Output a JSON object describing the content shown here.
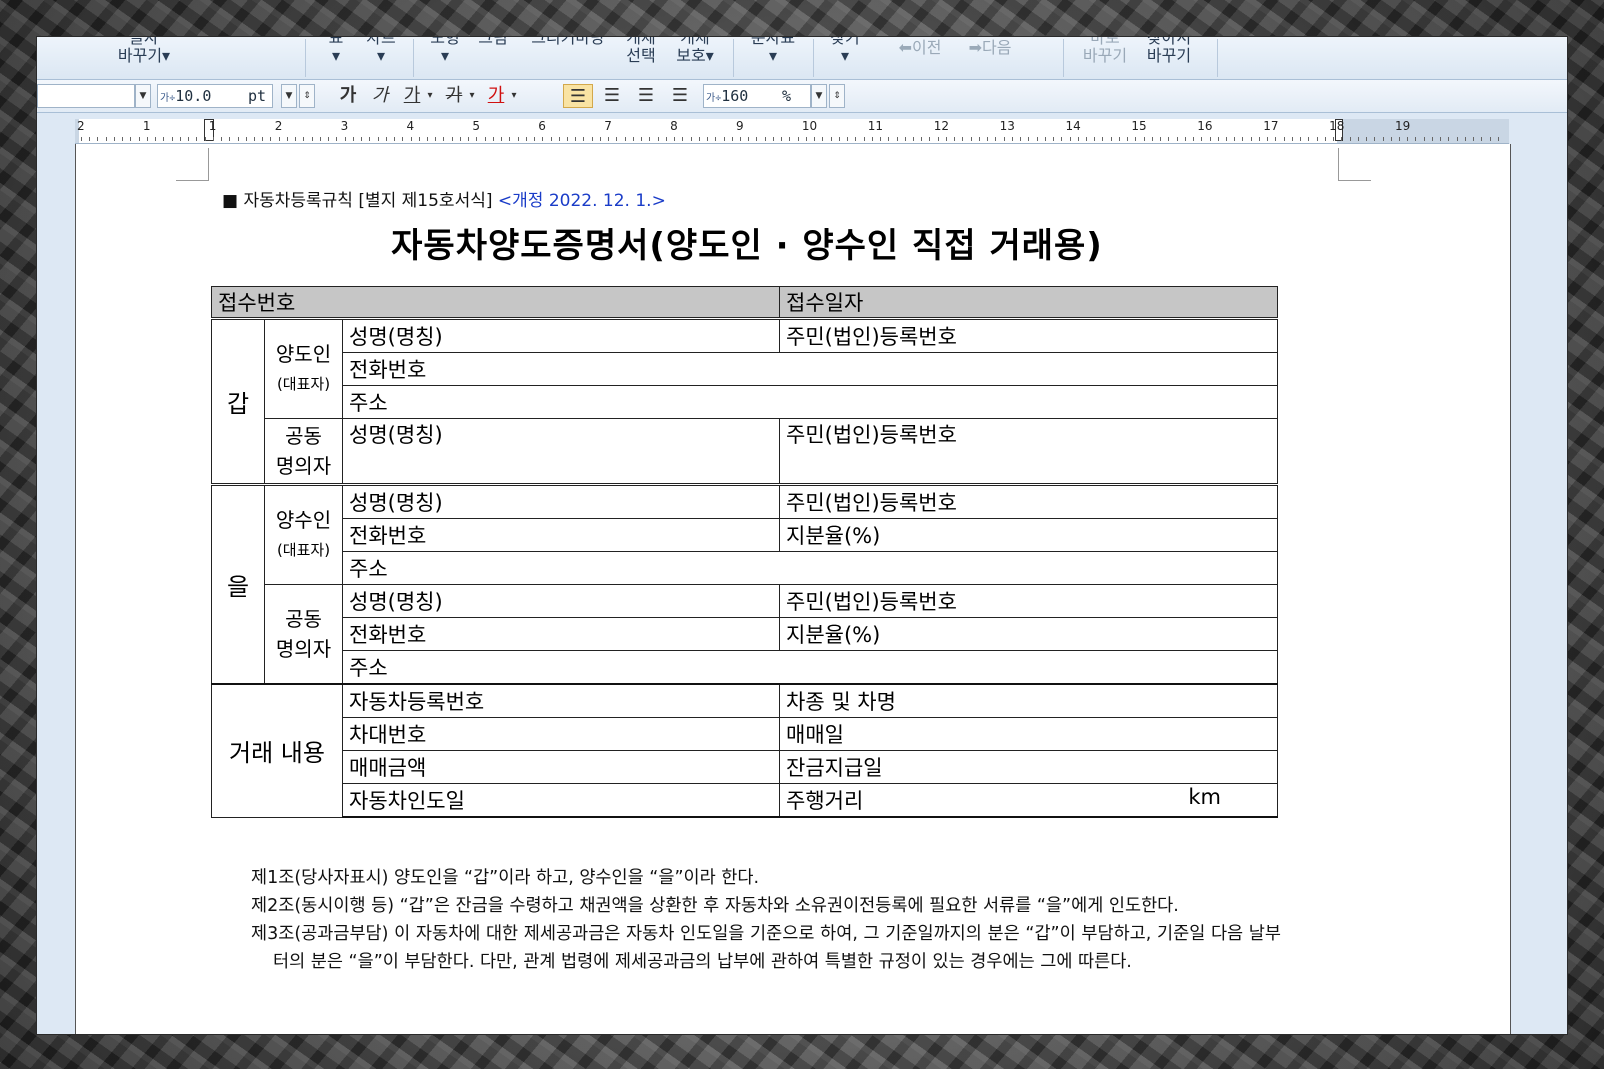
{
  "ribbon": {
    "groups": [
      {
        "top": "글자",
        "bottom": "바꾸기▾"
      },
      {
        "top": "표",
        "bottom": "▾"
      },
      {
        "top": "차트",
        "bottom": "▾"
      },
      {
        "top": "도형",
        "bottom": "▾"
      },
      {
        "top": "그림",
        "bottom": ""
      },
      {
        "top": "그리기마당",
        "bottom": ""
      },
      {
        "top": "개체",
        "bottom": "선택"
      },
      {
        "top": "개체",
        "bottom": "보호▾"
      },
      {
        "top": "문자표",
        "bottom": "▾"
      },
      {
        "top": "찾기",
        "bottom": "▾"
      }
    ],
    "prev_label": "이전",
    "next_label": "다음",
    "replace_top": "바로",
    "replace_bottom": "바꾸기",
    "find_replace_top": "찾아서",
    "find_replace_bottom": "바꾸기"
  },
  "format_toolbar": {
    "font_size_icon": "가\n가",
    "font_size": "10.0",
    "font_unit": "pt",
    "bold": "가",
    "italic": "가",
    "underline": "가",
    "strike": "가",
    "color": "가",
    "line_spacing_icon": "가\n가",
    "line_spacing": "160",
    "line_spacing_unit": "%"
  },
  "ruler": {
    "numbers": [
      "2",
      "1",
      "1",
      "2",
      "3",
      "4",
      "5",
      "6",
      "7",
      "8",
      "9",
      "10",
      "11",
      "12",
      "13",
      "14",
      "15",
      "16",
      "17",
      "18",
      "19"
    ]
  },
  "document": {
    "ref": "■ 자동차등록규칙 [별지 제15호서식]",
    "amend": "<개정 2022. 12. 1.>",
    "title": "자동차양도증명서(양도인 · 양수인 직접 거래용)",
    "receipt_no": "접수번호",
    "receipt_date": "접수일자",
    "gap": "갑",
    "eul": "을",
    "transferor": "양도인",
    "rep": "(대표자)",
    "co_owner_1": "공동",
    "co_owner_2": "명의자",
    "transferee": "양수인",
    "name": "성명(명칭)",
    "reg_no": "주민(법인)등록번호",
    "phone": "전화번호",
    "address": "주소",
    "share": "지분율(%)",
    "transaction": "거래 내용",
    "vehicle_reg_no": "자동차등록번호",
    "model": "차종 및 차명",
    "vin": "차대번호",
    "sale_date": "매매일",
    "sale_amount": "매매금액",
    "balance_date": "잔금지급일",
    "delivery_date": "자동차인도일",
    "mileage": "주행거리",
    "km": "km"
  },
  "clauses": [
    "제1조(당사자표시) 양도인을 “갑”이라 하고, 양수인을 “을”이라 한다.",
    "제2조(동시이행 등) “갑”은 잔금을 수령하고 채권액을 상환한 후 자동차와 소유권이전등록에 필요한 서류를 “을”에게 인도한다.",
    "제3조(공과금부담) 이 자동차에 대한 제세공과금은 자동차 인도일을 기준으로 하여, 그 기준일까지의 분은 “갑”이 부담하고, 기준일 다음 날부터의 분은 “을”이 부담한다. 다만, 관계 법령에 제세공과금의 납부에 관하여 특별한 규정이 있는 경우에는 그에 따른다."
  ],
  "colors": {
    "amend_blue": "#1a3cc8",
    "header_gray": "#c6c6c6",
    "ribbon_bg": "#dbe7f3"
  }
}
